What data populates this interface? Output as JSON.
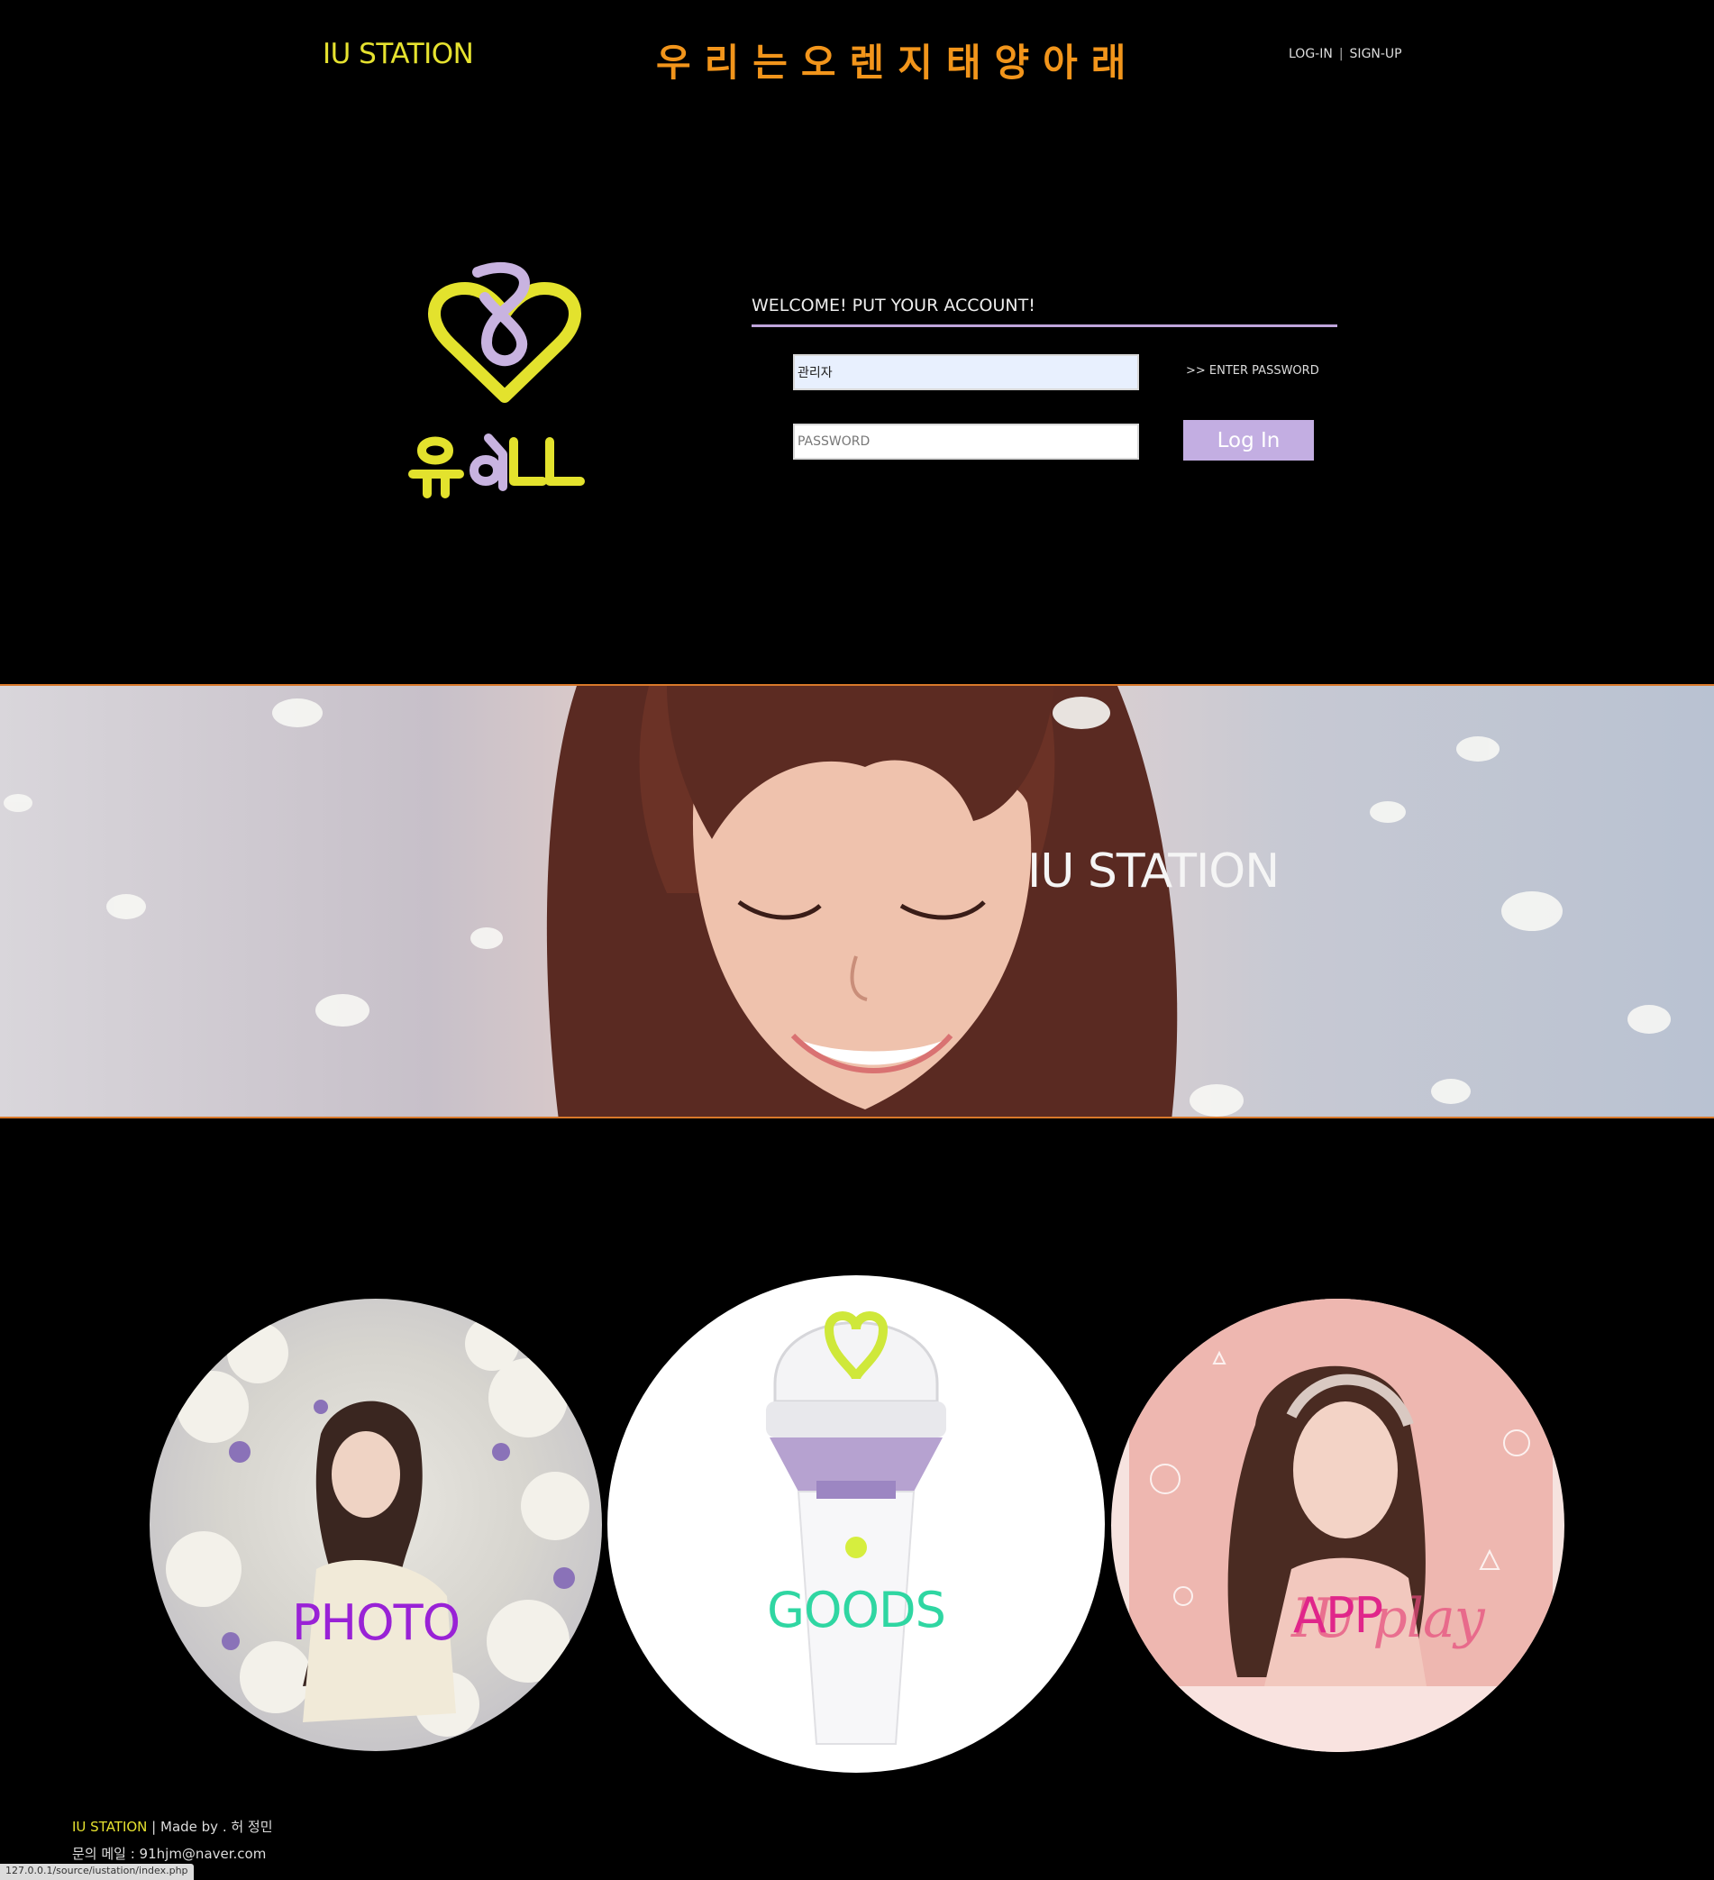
{
  "header": {
    "brand": "IU STATION",
    "slogan": "우리는오렌지태양아래",
    "login_link": "LOG-IN",
    "separator": "|",
    "signup_link": "SIGN-UP"
  },
  "login": {
    "logo_text": "유애나",
    "welcome": "WELCOME! PUT YOUR ACCOUNT!",
    "id_value": "관리자",
    "password_placeholder": "PASSWORD",
    "hint": ">> ENTER PASSWORD",
    "button_label": "Log In"
  },
  "banner": {
    "title": "IU STATION"
  },
  "categories": [
    {
      "label": "PHOTO",
      "color": "#9922d6"
    },
    {
      "label": "GOODS",
      "color": "#2fd6a2"
    },
    {
      "label": "APP",
      "color": "#e0268a"
    }
  ],
  "app_overlay": "IU play",
  "footer": {
    "brand": "IU STATION",
    "made_by": " | Made by . 허 정민",
    "contact": "문의 메일 : 91hjm@naver.com"
  },
  "status_url": "127.0.0.1/source/iustation/index.php",
  "colors": {
    "brand_yellow": "#e6e22f",
    "slogan_orange": "#f2951b",
    "accent_lavender": "#c3aee2"
  }
}
